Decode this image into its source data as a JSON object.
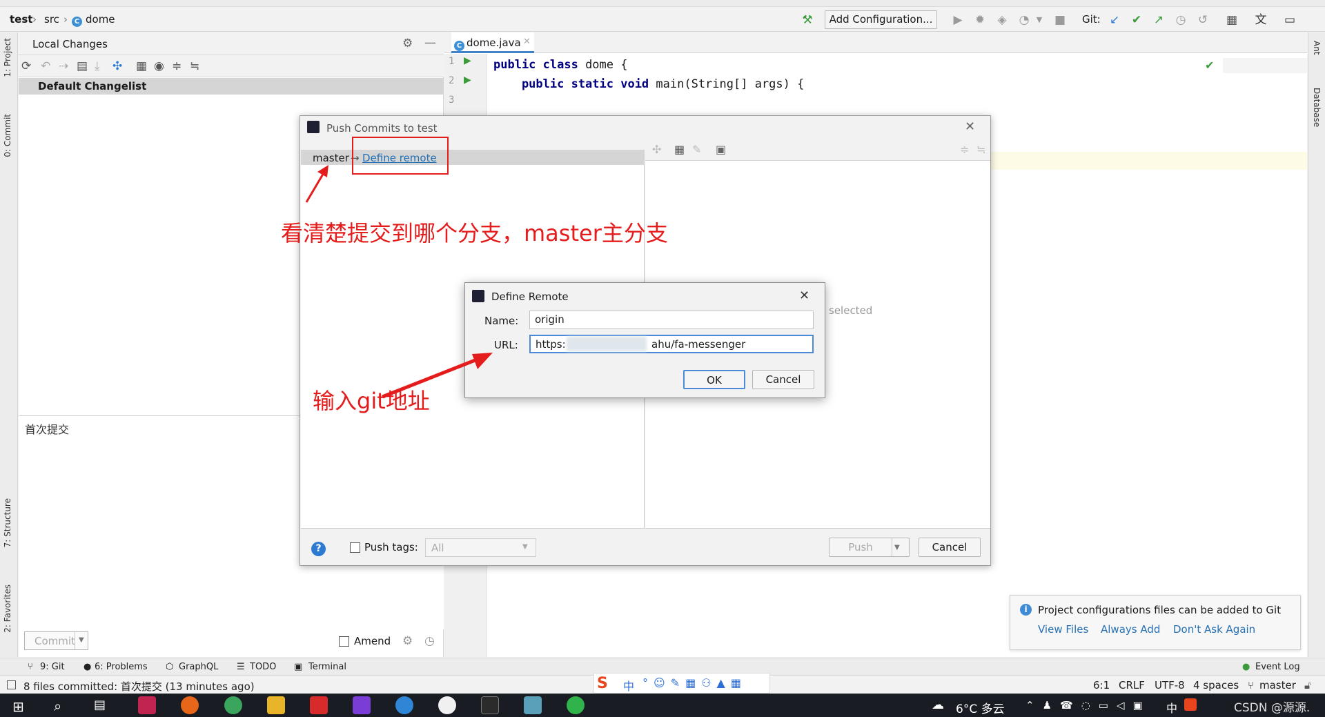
{
  "nav": {
    "project": "test",
    "folder": "src",
    "file": "dome",
    "add_config": "Add Configuration...",
    "git_label": "Git:"
  },
  "left_tabs": {
    "project": "1: Project",
    "commit": "0: Commit",
    "structure": "7: Structure",
    "favorites": "2: Favorites"
  },
  "right_tabs": {
    "ant": "Ant",
    "database": "Database"
  },
  "commit_panel": {
    "title": "Local Changes",
    "changelist": "Default Changelist",
    "message": "首次提交",
    "commit_button": "Commit",
    "amend_label": "Amend"
  },
  "editor": {
    "tab_label": "dome.java",
    "lines": [
      {
        "num": "1",
        "kw": "public class",
        "rest": " dome {"
      },
      {
        "num": "2",
        "kw": "    public static void",
        "rest": " main(String[] args) {"
      },
      {
        "num": "3",
        "kw": "",
        "rest": ""
      }
    ]
  },
  "push_dialog": {
    "title": "Push Commits to test",
    "branch": "master",
    "arrow": "→",
    "define_remote_link": "Define remote",
    "right_hint": "selected",
    "push_tags_label": "Push tags:",
    "tags_value": "All",
    "push_button": "Push",
    "cancel_button": "Cancel",
    "help_glyph": "?"
  },
  "remote_dialog": {
    "title": "Define Remote",
    "name_label": "Name:",
    "name_value": "origin",
    "url_label": "URL:",
    "url_start": "https:",
    "url_end": "ahu/fa-messenger",
    "ok_button": "OK",
    "cancel_button": "Cancel"
  },
  "annotations": {
    "branch_note": "看清楚提交到哪个分支，master主分支",
    "url_note": "输入git地址"
  },
  "notification": {
    "message": "Project configurations files can be added to Git",
    "view_files": "View Files",
    "always_add": "Always Add",
    "dont_ask": "Don't Ask Again"
  },
  "tool_tabs": {
    "git": "9: Git",
    "problems": "6: Problems",
    "graphql": "GraphQL",
    "todo": "TODO",
    "terminal": "Terminal",
    "event_log": "Event Log"
  },
  "status": {
    "message": "8 files committed: 首次提交 (13 minutes ago)",
    "position": "6:1",
    "line_sep": "CRLF",
    "encoding": "UTF-8",
    "indent": "4 spaces",
    "branch": "master"
  },
  "taskbar": {
    "weather": "6°C 多云",
    "ime": "中",
    "watermark": "CSDN @源源."
  },
  "colors": {
    "accent_red": "#e51c1c",
    "link_blue": "#2470b3",
    "run_green": "#3b9b3b"
  }
}
